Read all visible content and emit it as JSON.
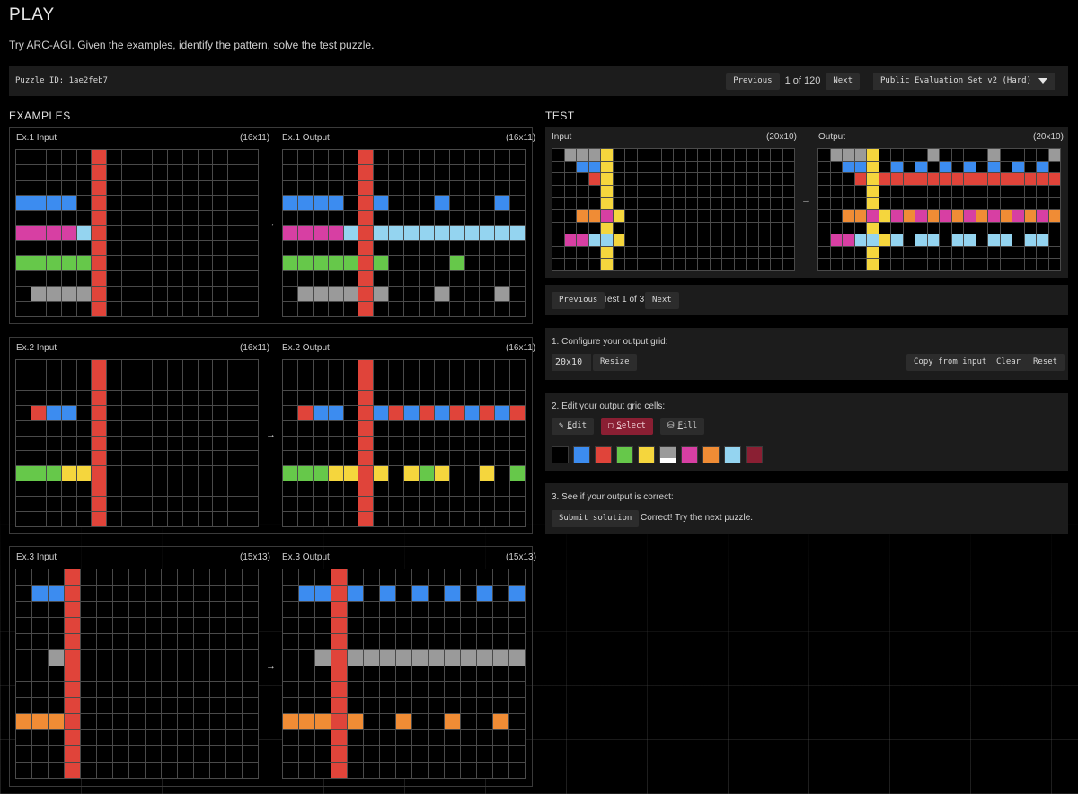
{
  "header": {
    "title": "PLAY",
    "subtitle": "Try ARC-AGI. Given the examples, identify the pattern, solve the test puzzle."
  },
  "puzzle_bar": {
    "puzzle_id": "Puzzle ID: 1ae2feb7",
    "previous_label": "Previous",
    "counter": "1 of 120",
    "next_label": "Next",
    "set_label": "Public Evaluation Set v2 (Hard)"
  },
  "examples_title": "EXAMPLES",
  "test_title": "TEST",
  "palette": {
    "0": "#000000",
    "1": "#3c8cf0",
    "2": "#e0443a",
    "3": "#66c84a",
    "4": "#f5d63d",
    "5": "#9a9a9a",
    "6": "#d73fa3",
    "7": "#f08c35",
    "8": "#94d4f0",
    "9": "#8a1f33"
  },
  "examples": [
    {
      "input_label": "Ex.1 Input",
      "input_size": "(16x11)",
      "output_label": "Ex.1 Output",
      "output_size": "(16x11)",
      "arrow": "→",
      "input": [
        "0000020000000000",
        "0000020000000000",
        "0000020000000000",
        "1111020000000000",
        "0000020000000000",
        "6666820000000000",
        "0000020000000000",
        "3333320000000000",
        "0000020000000000",
        "0555520000000000",
        "0000020000000000"
      ],
      "output": [
        "0000020000000000",
        "0000020000000000",
        "0000020000000000",
        "1111021000100010",
        "0000020000000000",
        "6666828888888888",
        "0000020000000000",
        "3333323000030000",
        "0000020000000000",
        "0555525000500050",
        "0000020000000000"
      ]
    },
    {
      "input_label": "Ex.2 Input",
      "input_size": "(16x11)",
      "output_label": "Ex.2 Output",
      "output_size": "(16x11)",
      "arrow": "→",
      "input": [
        "0000020000000000",
        "0000020000000000",
        "0000020000000000",
        "0211020000000000",
        "0000020000000000",
        "0000020000000000",
        "0000020000000000",
        "3334420000000000",
        "0000020000000000",
        "0000020000000000",
        "0000020000000000"
      ],
      "output": [
        "0000020000000000",
        "0000020000000000",
        "0000020000000000",
        "0211021212121212",
        "0000020000000000",
        "0000020000000000",
        "0000020000000000",
        "3334424043400403",
        "0000020000000000",
        "0000020000000000",
        "0000020000000000"
      ]
    },
    {
      "input_label": "Ex.3 Input",
      "input_size": "(15x13)",
      "output_label": "Ex.3 Output",
      "output_size": "(15x13)",
      "arrow": "→",
      "input": [
        "000200000000000",
        "011200000000000",
        "000200000000000",
        "000200000000000",
        "000200000000000",
        "005200000000000",
        "000200000000000",
        "000200000000000",
        "000200000000000",
        "777200000000000",
        "000200000000000",
        "000200000000000",
        "000200000000000"
      ],
      "output": [
        "000200000000000",
        "011210101010101",
        "000200000000000",
        "000200000000000",
        "000200000000000",
        "005255555555555",
        "000200000000000",
        "000200000000000",
        "000200000000000",
        "777270070070070",
        "000200000000000",
        "000200000000000",
        "000200000000000"
      ]
    }
  ],
  "test": {
    "input_label": "Input",
    "input_size": "(20x10)",
    "output_label": "Output",
    "output_size": "(20x10)",
    "arrow": "→",
    "input": [
      "05554000000000000000",
      "00114000000000000000",
      "00024000000000000000",
      "00004000000000000000",
      "00004000000000000000",
      "00776400000000000000",
      "00004000000000000000",
      "06688400000000000000",
      "00004000000000000000",
      "00004000000000000000"
    ],
    "output": [
      "05554000050000500005",
      "00114010101010101010",
      "00024222222222222222",
      "00004000000000000000",
      "00004000000000000000",
      "00776467676767676767",
      "00004000000000000000",
      "06688480880880880880",
      "00004000000000000000",
      "00004000000000000000"
    ],
    "previous_label": "Previous",
    "counter": "Test 1 of 3",
    "next_label": "Next"
  },
  "configure": {
    "heading": "1. Configure your output grid:",
    "size_value": "20x10",
    "resize_label": "Resize",
    "copy_label": "Copy from input",
    "clear_label": "Clear",
    "reset_label": "Reset"
  },
  "edit": {
    "heading": "2. Edit your output grid cells:",
    "tools": [
      {
        "first": "E",
        "rest": "dit",
        "icon": "pencil-icon",
        "glyph": "✎"
      },
      {
        "first": "S",
        "rest": "elect",
        "icon": "select-square-icon",
        "glyph": "▢"
      },
      {
        "first": "F",
        "rest": "ill",
        "icon": "fill-bucket-icon",
        "glyph": "⛁"
      }
    ],
    "swatches": [
      "#000000",
      "#3c8cf0",
      "#e0443a",
      "#66c84a",
      "#f5d63d",
      "#9a9a9a",
      "#d73fa3",
      "#f08c35",
      "#94d4f0",
      "#8a1f33"
    ]
  },
  "submit": {
    "heading": "3. See if your output is correct:",
    "button_label": "Submit solution",
    "result_text": "Correct! Try the next puzzle."
  }
}
